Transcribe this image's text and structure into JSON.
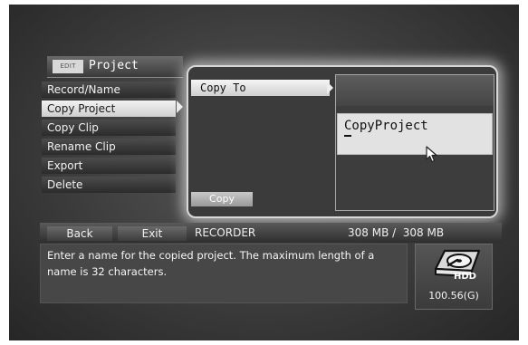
{
  "header": {
    "badge": "EDIT",
    "title": "Project"
  },
  "menu": {
    "items": [
      {
        "label": "Record/Name",
        "selected": false
      },
      {
        "label": "Copy Project",
        "selected": true
      },
      {
        "label": "Copy Clip",
        "selected": false
      },
      {
        "label": "Rename Clip",
        "selected": false
      },
      {
        "label": "Export",
        "selected": false
      },
      {
        "label": "Delete",
        "selected": false
      }
    ]
  },
  "panel": {
    "copy_to_label": "Copy To",
    "name_value": "CopyProject",
    "copy_button": "Copy"
  },
  "bottom_bar": {
    "back": "Back",
    "exit": "Exit",
    "destination": "RECORDER",
    "storage": "308 MB /  308 MB"
  },
  "message": "Enter a name for the copied project. The maximum length of a name is 32 characters.",
  "hdd": {
    "label": "HDD",
    "capacity": "100.56(G)"
  },
  "icons": {
    "menu_arrow": "right-arrow-icon",
    "copy_to_arrow": "right-arrow-icon",
    "cursor": "mouse-pointer-icon",
    "drive": "hdd-icon"
  }
}
